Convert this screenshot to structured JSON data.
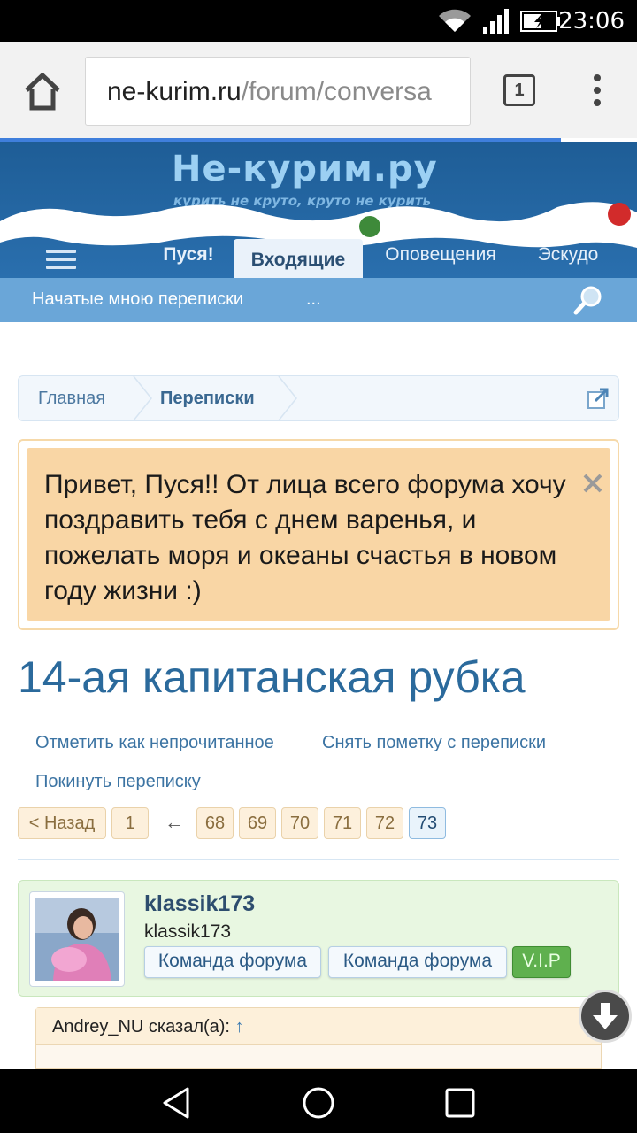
{
  "status_bar": {
    "time": "23:06"
  },
  "browser": {
    "url_domain": "ne-kurim.ru",
    "url_rest": "/forum/conversa",
    "tab_count": "1"
  },
  "forum": {
    "logo_text": "Не-курим.ру",
    "logo_tagline": "курить не круто, круто не курить",
    "nav_tabs": [
      {
        "label": "Пуся!"
      },
      {
        "label": "Входящие"
      },
      {
        "label": "Оповещения"
      },
      {
        "label": "Эскудо"
      }
    ],
    "subnav": [
      {
        "label": "Начатые мною переписки"
      },
      {
        "label": "..."
      }
    ]
  },
  "breadcrumb": [
    {
      "label": "Главная"
    },
    {
      "label": "Переписки"
    }
  ],
  "notice": {
    "text": "Привет, Пуся!! От лица всего форума хочу поздравить тебя с днем варенья, и пожелать моря и океаны счастья в новом году жизни :)"
  },
  "thread": {
    "title": "14-ая капитанская рубка",
    "actions": [
      {
        "label": "Отметить как непрочитанное"
      },
      {
        "label": "Снять пометку с переписки"
      },
      {
        "label": "Покинуть переписку"
      }
    ]
  },
  "pagination": {
    "back": "< Назад",
    "first": "1",
    "ellipsis": "←",
    "pages": [
      "68",
      "69",
      "70",
      "71",
      "72",
      "73"
    ],
    "current": "73"
  },
  "message": {
    "username": "klassik173",
    "user_title": "klassik173",
    "badges": [
      "Команда форума",
      "Команда форума",
      "V.I.P"
    ]
  },
  "quote": {
    "author": "Andrey_NU сказал(а):",
    "arrow": "↑"
  },
  "colors": {
    "accent": "#2b6a9c",
    "header_bg": "#1e5d96",
    "subnav_bg": "#6aa6d8",
    "notice_bg": "#f9d6a5",
    "message_bg": "#e8f7e1"
  }
}
